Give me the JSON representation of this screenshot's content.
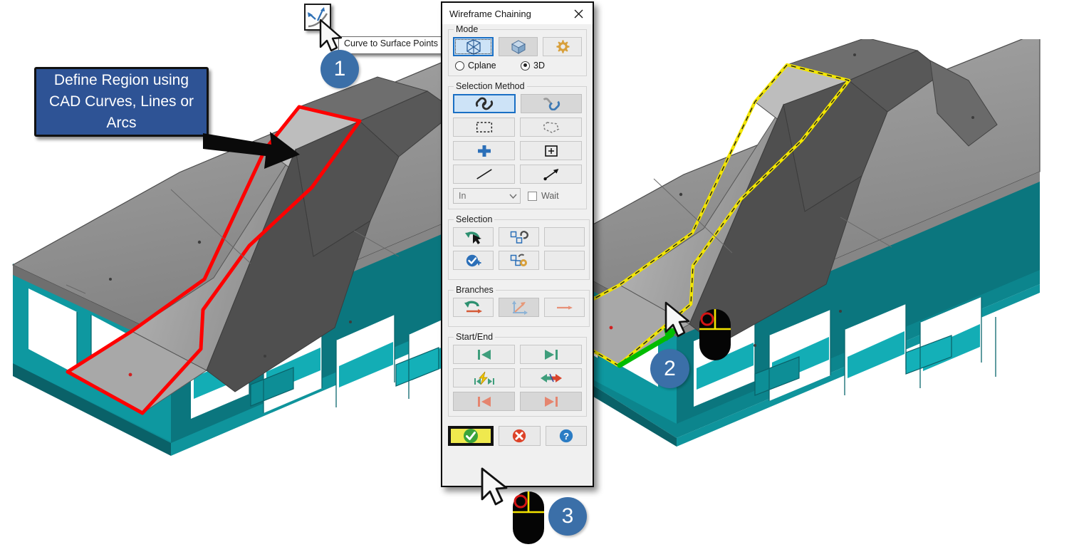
{
  "dialog": {
    "title": "Wireframe Chaining",
    "close_icon": "close-icon",
    "groups": {
      "mode": {
        "legend": "Mode",
        "buttons": [
          {
            "name": "mode-wireframe-button",
            "icon": "wireframe-cube-icon",
            "state": "selected"
          },
          {
            "name": "mode-solid-button",
            "icon": "solid-cube-icon",
            "state": "normal"
          },
          {
            "name": "mode-options-button",
            "icon": "gear-icon",
            "state": "normal"
          }
        ],
        "radios": [
          {
            "label": "Cplane",
            "checked": false
          },
          {
            "label": "3D",
            "checked": true
          }
        ]
      },
      "selection_method": {
        "legend": "Selection Method",
        "buttons": [
          {
            "name": "chain-button",
            "icon": "chain-link-icon",
            "state": "selected"
          },
          {
            "name": "partial-chain-button",
            "icon": "partial-chain-icon",
            "state": "normal"
          },
          {
            "name": "window-button",
            "icon": "dashed-rectangle-icon",
            "state": "normal"
          },
          {
            "name": "polygon-button",
            "icon": "dashed-polygon-icon",
            "state": "normal"
          },
          {
            "name": "single-point-button",
            "icon": "blue-plus-icon",
            "state": "normal"
          },
          {
            "name": "point-box-button",
            "icon": "boxed-plus-icon",
            "state": "normal"
          },
          {
            "name": "single-entity-button",
            "icon": "diagonal-line-icon",
            "state": "normal"
          },
          {
            "name": "vector-button",
            "icon": "arrow-vector-icon",
            "state": "normal"
          }
        ],
        "mode_select": {
          "value": "In",
          "chevron_icon": "chevron-down-icon"
        },
        "wait_checkbox": {
          "label": "Wait",
          "checked": false
        }
      },
      "selection": {
        "legend": "Selection",
        "buttons": [
          {
            "name": "undo-selection-button",
            "icon": "green-undo-arrow-cursor-icon",
            "state": "normal"
          },
          {
            "name": "edit-selection-button",
            "icon": "two-squares-chain-icon",
            "state": "normal"
          },
          {
            "name": "selection-extra-button",
            "icon": "hidden-icon",
            "state": "occluded"
          },
          {
            "name": "select-all-button",
            "icon": "blue-check-circle-plus-icon",
            "state": "normal"
          },
          {
            "name": "selection-settings-button",
            "icon": "two-squares-gear-icon",
            "state": "normal"
          },
          {
            "name": "selection-extra-2-button",
            "icon": "hidden-icon",
            "state": "occluded"
          }
        ]
      },
      "branches": {
        "legend": "Branches",
        "buttons": [
          {
            "name": "branch-undo-button",
            "icon": "green-arrow-red-arrow-icon",
            "state": "normal"
          },
          {
            "name": "branch-axes-button",
            "icon": "blue-axes-orange-arrow-icon",
            "state": "disabled"
          },
          {
            "name": "branch-extra-button",
            "icon": "red-arrow-icon",
            "state": "occluded"
          }
        ]
      },
      "start_end": {
        "legend": "Start/End",
        "buttons": [
          {
            "name": "go-to-start-button",
            "icon": "green-skip-back-icon",
            "state": "normal"
          },
          {
            "name": "go-to-end-button",
            "icon": "green-skip-forward-icon",
            "state": "normal"
          },
          {
            "name": "dynamic-startend-button",
            "icon": "lightning-skip-icon",
            "state": "normal"
          },
          {
            "name": "reverse-direction-button",
            "icon": "green-red-double-arrow-icon",
            "state": "normal"
          },
          {
            "name": "reset-start-button",
            "icon": "red-skip-back-icon",
            "state": "disabled"
          },
          {
            "name": "reset-end-button",
            "icon": "red-skip-forward-icon",
            "state": "disabled"
          }
        ]
      }
    },
    "footer": [
      {
        "name": "ok-button",
        "icon": "green-check-icon",
        "state": "highlighted"
      },
      {
        "name": "cancel-button",
        "icon": "red-x-icon",
        "state": "normal"
      },
      {
        "name": "help-button",
        "icon": "blue-question-icon",
        "state": "normal"
      }
    ]
  },
  "toolbar": {
    "curve_to_surface_points": {
      "name": "curve-to-surface-points-button",
      "icon": "curve-to-surface-points-icon",
      "tooltip": "Curve to Surface Points"
    }
  },
  "callout": {
    "line1": "Define Region using",
    "line2": "CAD Curves, Lines  or",
    "line3": "Arcs",
    "background": "#2E5395",
    "text_color": "#FFFFFF"
  },
  "steps": [
    {
      "number": "1",
      "name": "step-badge-1"
    },
    {
      "number": "2",
      "name": "step-badge-2"
    },
    {
      "number": "3",
      "name": "step-badge-3"
    }
  ],
  "viewport": {
    "left_model": {
      "name": "cad-model-left",
      "body_color": "#0D9AA3",
      "body_dark_color": "#0A6E74",
      "top_plate_color": "#9B9B9B",
      "highlight_color": "#FF0000",
      "highlight_style": "solid"
    },
    "right_model": {
      "name": "cad-model-right",
      "body_color": "#0D9AA3",
      "body_dark_color": "#0A6E74",
      "top_plate_color": "#9B9B9B",
      "highlight_color": "#F2E500",
      "highlight_style": "dashed",
      "direction_arrow_color": "#00C000"
    }
  },
  "cursors": {
    "tooltip_cursor": "mouse-pointer-icon",
    "model_cursor": "mouse-pointer-icon",
    "ok_cursor": "mouse-pointer-icon"
  },
  "mouse_icons": [
    {
      "name": "mouse-left-click-icon-2",
      "button": "left"
    },
    {
      "name": "mouse-left-click-icon-3",
      "button": "left"
    }
  ]
}
